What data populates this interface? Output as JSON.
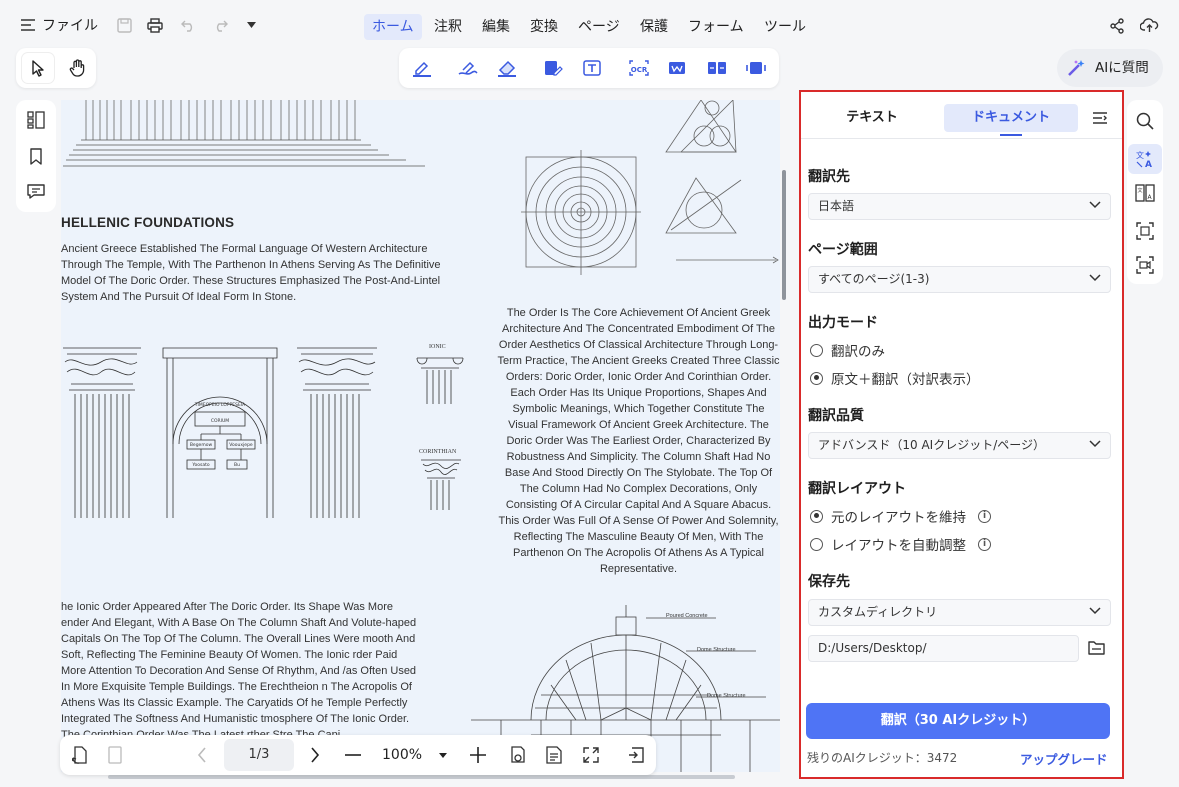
{
  "menu": {
    "file": "ファイル",
    "tabs": [
      "ホーム",
      "注釈",
      "編集",
      "変換",
      "ページ",
      "保護",
      "フォーム",
      "ツール"
    ],
    "ai_button": "AIに質問"
  },
  "document": {
    "heading": "HELLENIC FOUNDATIONS",
    "intro": "Ancient Greece Established The Formal Language Of Western Architecture Through The Temple, With The Parthenon In Athens Serving As The Definitive Model Of The Doric Order. These Structures Emphasized The Post-And-Lintel System And The Pursuit Of Ideal Form In Stone.",
    "col_right": "The Order Is The Core Achievement Of Ancient Greek Architecture And The Concentrated Embodiment Of The Order Aesthetics Of Classical Architecture Through Long-Term Practice, The Ancient Greeks Created Three Classic Orders: Doric Order, Ionic Order And Corinthian Order. Each Order Has Its Unique Proportions, Shapes And Symbolic Meanings, Which Together Constitute The Visual Framework Of Ancient Greek Architecture. The Doric Order Was The Earliest Order, Characterized By Robustness And Simplicity. The Column Shaft Had No Base And Stood Directly On The Stylobate. The Top Of The Column Had No Complex Decorations, Only Consisting Of A Circular Capital And A Square Abacus. This Order Was Full Of A Sense Of Power And Solemnity, Reflecting The Masculine Beauty Of Men, With The Parthenon On The Acropolis Of Athens As A Typical Representative.",
    "col_bottom": "he Ionic Order Appeared After The Doric Order. Its Shape Was More ender And Elegant, With A Base On The Column Shaft And Volute-haped Capitals On The Top Of The Column. The Overall Lines Were mooth And Soft, Reflecting The Feminine Beauty Of Women. The Ionic rder Paid More Attention To Decoration And Sense Of Rhythm, And /as Often Used In More Exquisite Temple Buildings. The Erechtheion n The Acropolis Of Athens Was Its Classic Example. The Caryatids Of he Temple Perfectly Integrated The Softness And Humanistic tmosphere Of The Ionic Order. The Corinthian Order Was The Latest rther Stre The Capi",
    "label_ionic": "IONIC",
    "label_corinthian": "CORINTHIAN",
    "label_d1": "Poured Concrete",
    "label_d2": "Dome Structure",
    "label_d3": "Dome Structure",
    "arch_label_top": "TIMEOPEIO LOPPESEIA",
    "arch_label_sub": "CORIUM",
    "arch_label_l": "Begemow",
    "arch_label_r": "Voouxjepe",
    "arch_label_bl": "Yoosato",
    "arch_label_br": "Bu"
  },
  "panel": {
    "tab_text": "テキスト",
    "tab_document": "ドキュメント",
    "target_title": "翻訳先",
    "target_value": "日本語",
    "range_title": "ページ範囲",
    "range_value": "すべてのページ(1-3)",
    "output_title": "出力モード",
    "output_opt1": "翻訳のみ",
    "output_opt2": "原文＋翻訳（対訳表示）",
    "quality_title": "翻訳品質",
    "quality_value": "アドバンスド（10 AIクレジット/ページ）",
    "layout_title": "翻訳レイアウト",
    "layout_opt1": "元のレイアウトを維持",
    "layout_opt2": "レイアウトを自動調整",
    "save_title": "保存先",
    "save_value": "カスタムディレクトリ",
    "save_path": "D:/Users/Desktop/",
    "translate_button": "翻訳（30 AIクレジット）",
    "credits": "残りのAIクレジット：3472",
    "upgrade": "アップグレード"
  },
  "bottom": {
    "page": "1/3",
    "zoom": "100%"
  }
}
